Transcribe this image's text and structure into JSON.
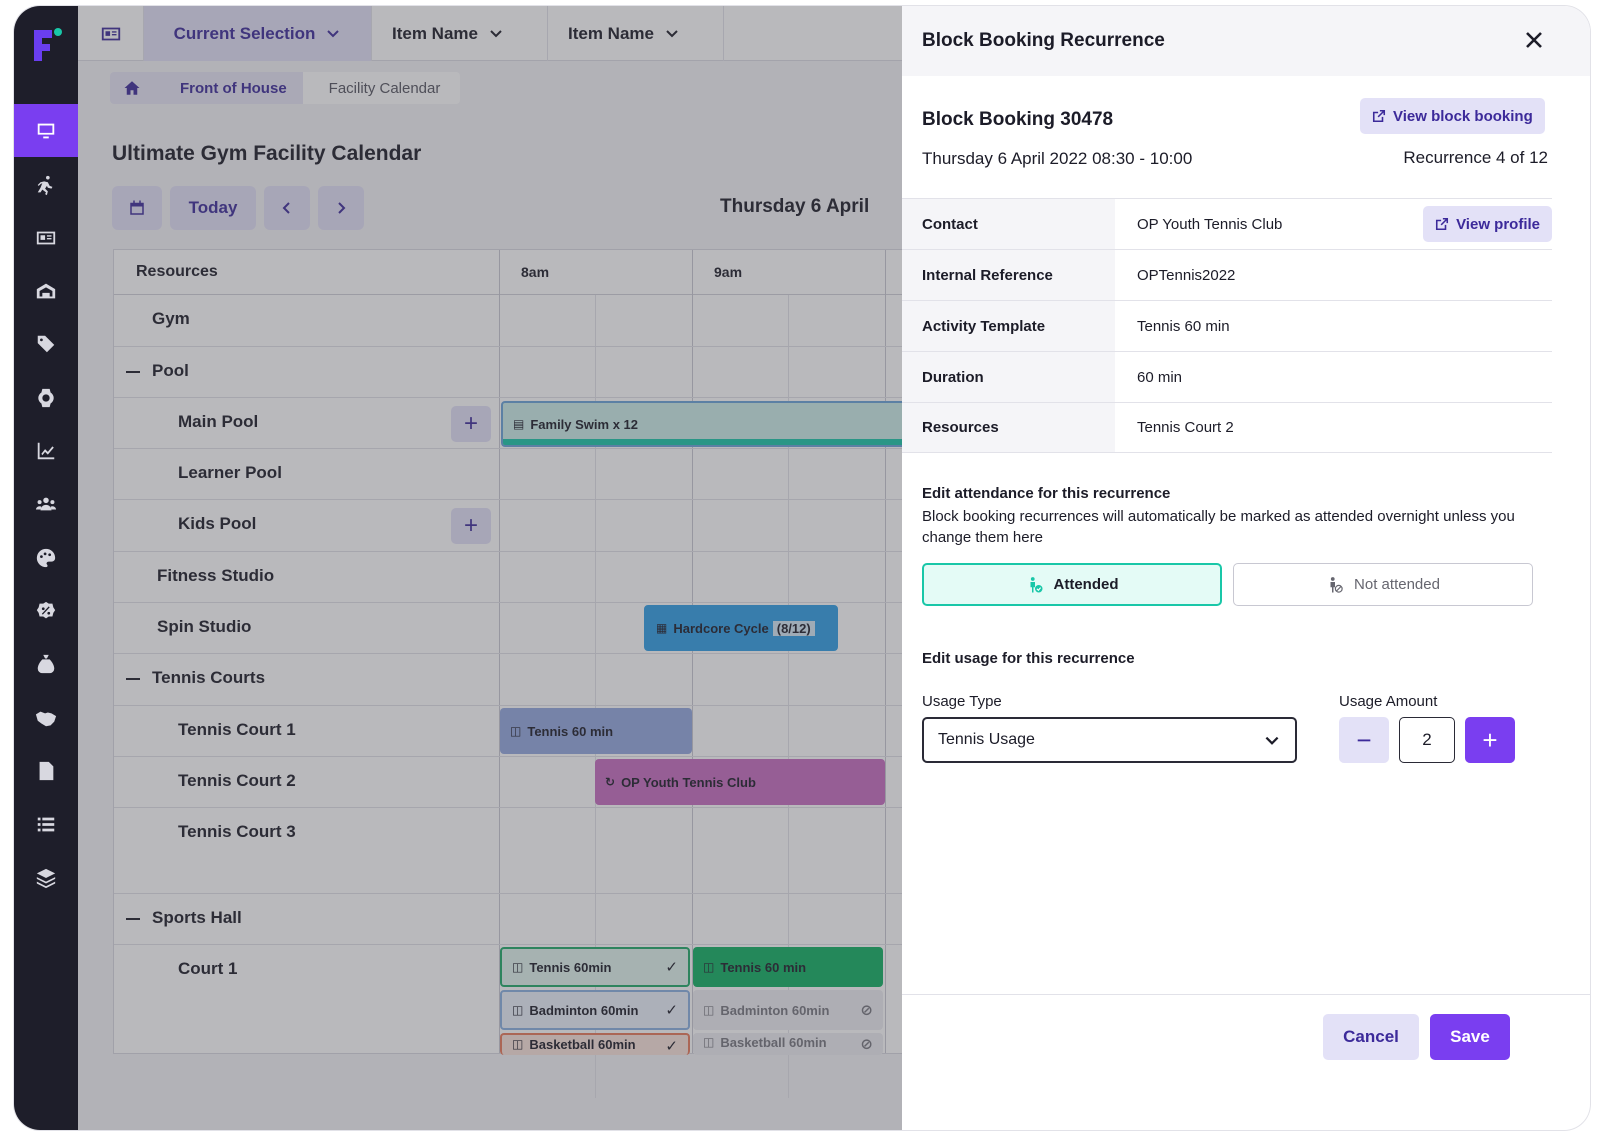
{
  "topbar": {
    "current_selection": "Current Selection",
    "item_name_1": "Item Name",
    "item_name_2": "Item Name"
  },
  "breadcrumb": {
    "link": "Front of  House",
    "current": "Facility Calendar"
  },
  "calendar": {
    "title": "Ultimate Gym Facility Calendar",
    "today_label": "Today",
    "date_label": "Thursday 6 April",
    "resources_header": "Resources",
    "time_labels": [
      "8am",
      "9am"
    ],
    "rows": [
      {
        "label": "Gym"
      },
      {
        "label": "Pool"
      },
      {
        "label": "Main Pool"
      },
      {
        "label": "Learner Pool"
      },
      {
        "label": "Kids Pool"
      },
      {
        "label": "Fitness Studio"
      },
      {
        "label": "Spin Studio"
      },
      {
        "label": "Tennis Courts"
      },
      {
        "label": "Tennis Court 1"
      },
      {
        "label": "Tennis Court 2"
      },
      {
        "label": "Tennis Court 3"
      },
      {
        "label": "Sports Hall"
      },
      {
        "label": "Court 1"
      }
    ],
    "events": {
      "family_swim": "Family Swim x 12",
      "hardcore_cycle": "Hardcore Cycle",
      "hardcore_cycle_count": "(8/12)",
      "tennis_court1": "Tennis 60 min",
      "op_youth": "OP Youth Tennis Club",
      "court1_tennis_a": "Tennis 60min",
      "court1_tennis_b": "Tennis 60 min",
      "court1_badminton_a": "Badminton 60min",
      "court1_badminton_b": "Badminton 60min",
      "court1_basketball_a": "Basketball 60min",
      "court1_basketball_b": "Basketball 60min"
    }
  },
  "panel": {
    "title": "Block Booking Recurrence",
    "booking_title": "Block Booking 30478",
    "booking_when": "Thursday 6 April 2022 08:30 - 10:00",
    "recurrence": "Recurrence 4 of 12",
    "view_block_booking": "View block booking",
    "view_profile": "View profile",
    "details": [
      {
        "key": "Contact",
        "value": "OP Youth Tennis Club"
      },
      {
        "key": "Internal Reference",
        "value": "OPTennis2022"
      },
      {
        "key": "Activity Template",
        "value": "Tennis 60 min"
      },
      {
        "key": "Duration",
        "value": "60 min"
      },
      {
        "key": "Resources",
        "value": "Tennis Court 2"
      }
    ],
    "attendance_title": "Edit attendance for this recurrence",
    "attendance_text": "Block booking recurrences will automatically be marked as attended overnight unless you change them here",
    "attended_label": "Attended",
    "not_attended_label": "Not attended",
    "usage_title": "Edit usage for this recurrence",
    "usage_type_label": "Usage Type",
    "usage_type_value": "Tennis Usage",
    "usage_amount_label": "Usage Amount",
    "usage_amount_value": "2",
    "cancel_label": "Cancel",
    "save_label": "Save"
  },
  "colors": {
    "accent": "#7a3ef0",
    "sidebar": "#1e1e2a",
    "attended_border": "#19c7a8"
  }
}
